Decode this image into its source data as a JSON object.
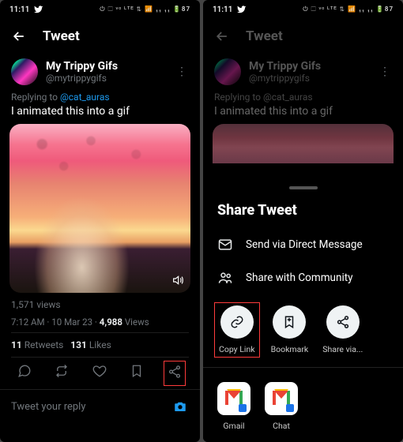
{
  "status": {
    "time": "11:11"
  },
  "header": {
    "title": "Tweet"
  },
  "tweet": {
    "display_name": "My Trippy Gifs",
    "handle": "@mytrippygifs",
    "reply_prefix": "Replying to ",
    "reply_handle": "@cat_auras",
    "text": "I animated this into a gif",
    "views": "1,571 views",
    "time": "7:12 AM",
    "date": "10 Mar 23",
    "view_count": "4,988",
    "view_label": "Views",
    "retweets_count": "11",
    "retweets_label": "Retweets",
    "likes_count": "131",
    "likes_label": "Likes"
  },
  "reply_bar": {
    "placeholder": "Tweet your reply"
  },
  "sheet": {
    "title": "Share Tweet",
    "dm": "Send via Direct Message",
    "community": "Share with Community",
    "copy": "Copy Link",
    "bookmark": "Bookmark",
    "sharevia": "Share via...",
    "gmail": "Gmail",
    "chat": "Chat"
  }
}
